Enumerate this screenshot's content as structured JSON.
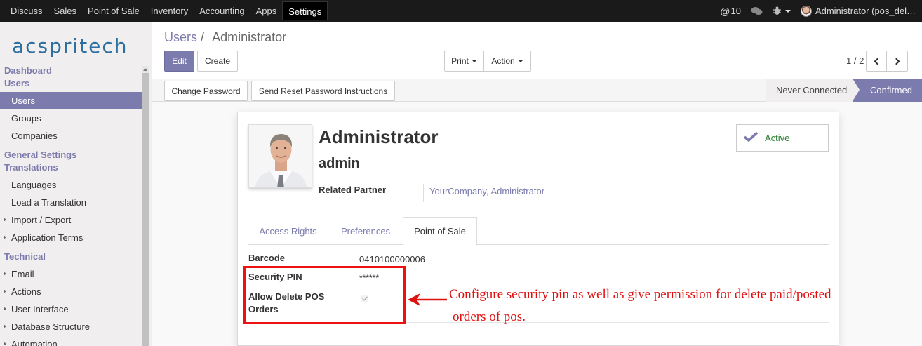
{
  "topbar": {
    "menu": [
      "Discuss",
      "Sales",
      "Point of Sale",
      "Inventory",
      "Accounting",
      "Apps",
      "Settings"
    ],
    "active_menu": "Settings",
    "notification_count": "10",
    "user": "Administrator (pos_del…"
  },
  "sidebar": {
    "logo": "acspritech",
    "sections": [
      {
        "head": [
          "Dashboard",
          "Users"
        ],
        "items": [
          {
            "label": "Users",
            "active": true,
            "sub": false
          },
          {
            "label": "Groups",
            "active": false,
            "sub": false
          },
          {
            "label": "Companies",
            "active": false,
            "sub": false
          }
        ]
      },
      {
        "head": [
          "General Settings",
          "Translations"
        ],
        "items": [
          {
            "label": "Languages",
            "active": false,
            "sub": false
          },
          {
            "label": "Load a Translation",
            "active": false,
            "sub": false
          },
          {
            "label": "Import / Export",
            "active": false,
            "sub": true
          },
          {
            "label": "Application Terms",
            "active": false,
            "sub": true
          }
        ]
      },
      {
        "head": [
          "Technical"
        ],
        "items": [
          {
            "label": "Email",
            "active": false,
            "sub": true
          },
          {
            "label": "Actions",
            "active": false,
            "sub": true
          },
          {
            "label": "User Interface",
            "active": false,
            "sub": true
          },
          {
            "label": "Database Structure",
            "active": false,
            "sub": true
          },
          {
            "label": "Automation",
            "active": false,
            "sub": true
          }
        ]
      }
    ]
  },
  "breadcrumb": {
    "parent": "Users",
    "sep": "/",
    "current": "Administrator"
  },
  "buttons": {
    "edit": "Edit",
    "create": "Create",
    "print": "Print",
    "action": "Action"
  },
  "pager": {
    "value": "1 / 2"
  },
  "status_buttons": {
    "change_password": "Change Password",
    "reset_password": "Send Reset Password Instructions"
  },
  "stages": {
    "never_connected": "Never Connected",
    "confirmed": "Confirmed"
  },
  "record": {
    "name": "Administrator",
    "login": "admin",
    "related_partner_label": "Related Partner",
    "related_partner": "YourCompany, Administrator",
    "active_label": "Active"
  },
  "tabs": [
    "Access Rights",
    "Preferences",
    "Point of Sale"
  ],
  "active_tab": "Point of Sale",
  "pos_fields": {
    "barcode_label": "Barcode",
    "barcode": "0410100000006",
    "security_pin_label": "Security PIN",
    "security_pin": "******",
    "allow_delete_label_1": "Allow Delete POS",
    "allow_delete_label_2": "Orders",
    "allow_delete": true
  },
  "annotation": {
    "line1": "Configure security pin as well as give permission for delete paid/posted",
    "line2": "orders of pos."
  },
  "colors": {
    "accent": "#7c7bad",
    "annotation": "#e01010",
    "topbar": "#1a1a1a"
  }
}
